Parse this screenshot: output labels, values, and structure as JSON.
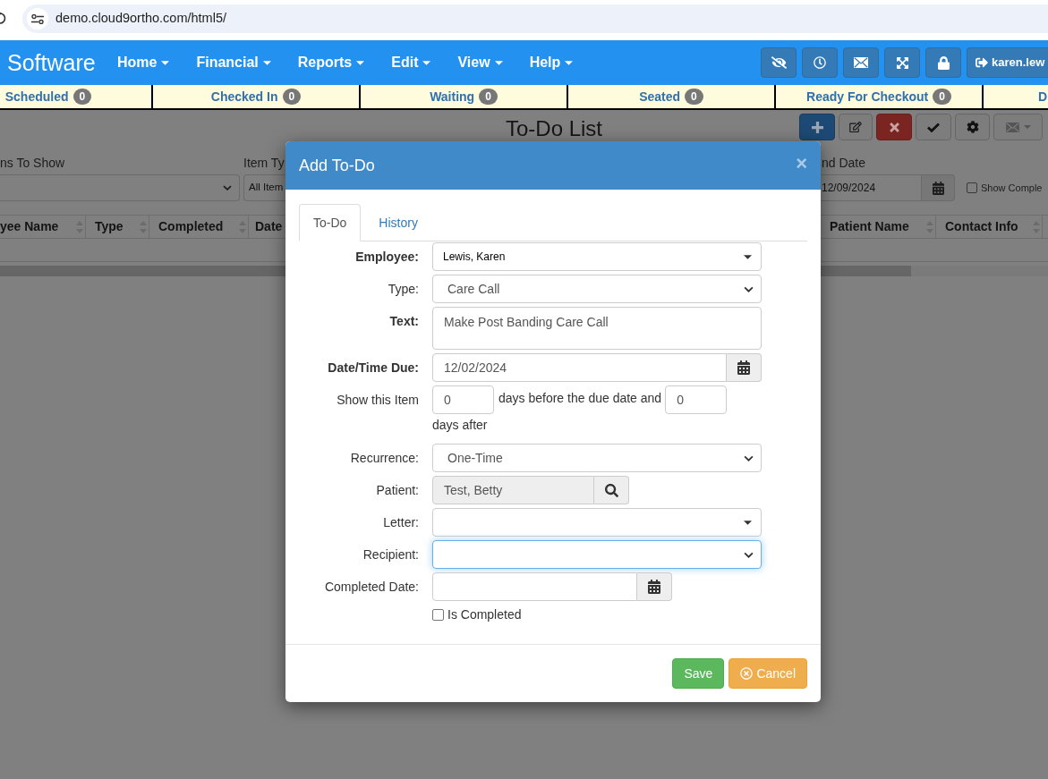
{
  "browser": {
    "url": "demo.cloud9ortho.com/html5/"
  },
  "navbar": {
    "logo": "Software",
    "menus": [
      "Home",
      "Financial",
      "Reports",
      "Edit",
      "View",
      "Help"
    ],
    "user": "karen.lew"
  },
  "status_bar": [
    {
      "label": "Scheduled",
      "count": "0"
    },
    {
      "label": "Checked In",
      "count": "0"
    },
    {
      "label": "Waiting",
      "count": "0"
    },
    {
      "label": "Seated",
      "count": "0"
    },
    {
      "label": "Ready For Checkout",
      "count": "0"
    },
    {
      "label": "D"
    }
  ],
  "page": {
    "title": "To-Do List",
    "filters": [
      {
        "label": "ns To Show"
      },
      {
        "label": "Item Ty",
        "value": "All Item"
      }
    ],
    "end_date": {
      "label": "nd Date",
      "value": "12/09/2024"
    },
    "show_completed": {
      "label": "Show Comple",
      "checked": false
    },
    "table": {
      "columns": [
        "yee Name",
        "Type",
        "Completed",
        "Date",
        "Patient Name",
        "Contact Info"
      ]
    }
  },
  "dialog": {
    "title": "Add To-Do",
    "close": "×",
    "tabs": [
      {
        "label": "To-Do",
        "selected": true
      },
      {
        "label": "History",
        "selected": false
      }
    ],
    "fields": [
      {
        "kind": "dropdown",
        "label": "Employee:",
        "value": "Lewis, Karen",
        "required": true,
        "focused": false
      },
      {
        "kind": "select",
        "label": "Type:",
        "value": "Care Call",
        "required": false,
        "focused": false
      },
      {
        "kind": "textarea",
        "label": "Text:",
        "value": "Make Post Banding Care Call",
        "required": true,
        "focused": false
      },
      {
        "kind": "datetime",
        "label": "Date/Time Due:",
        "value": "12/02/2024",
        "required": true,
        "focused": false
      },
      {
        "kind": "days",
        "label": "Show this Item",
        "before": "0",
        "between": "days before the due date and",
        "after": "0",
        "end": "days after",
        "required": false,
        "focused": false
      },
      {
        "kind": "select",
        "label": "Recurrence:",
        "value": "One-Time",
        "required": false,
        "focused": false
      },
      {
        "kind": "lookup",
        "label": "Patient:",
        "value": "Test, Betty",
        "required": false,
        "focused": false
      },
      {
        "kind": "dropdown",
        "label": "Letter:",
        "required": false,
        "focused": false
      },
      {
        "kind": "select",
        "label": "Recipient:",
        "required": false,
        "focused": true
      },
      {
        "kind": "date",
        "label": "Completed Date:",
        "required": false,
        "focused": false
      }
    ],
    "checkbox": {
      "label": "Is Completed",
      "checked": false
    },
    "buttons": [
      {
        "kind": "save",
        "label": "Save"
      },
      {
        "kind": "cancel",
        "label": "Cancel"
      }
    ]
  }
}
